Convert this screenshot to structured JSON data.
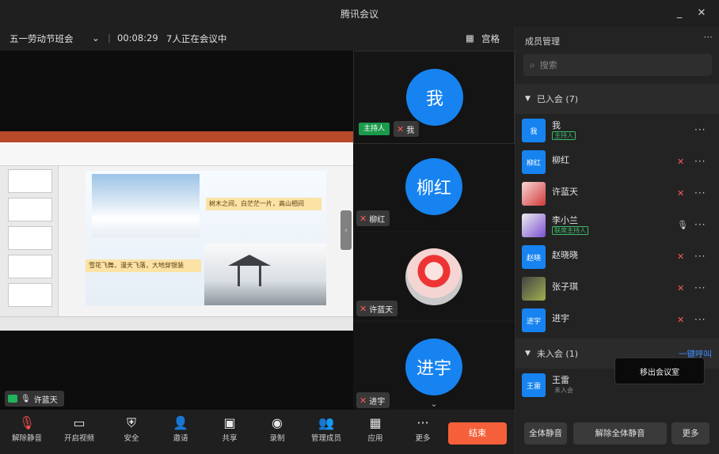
{
  "window": {
    "title": "腾讯会议",
    "buttons": {
      "minimize": "_",
      "close": "✕"
    }
  },
  "meeting_header": {
    "topic": "五一劳动节班会",
    "dropdown_icon": "chevron-down-icon",
    "elapsed": "00:08:29",
    "participants_status": "7人正在会议中",
    "grid_label": "宫格"
  },
  "stage": {
    "presenter_name": "许蓝天"
  },
  "slide": {
    "caption_top": "树木之间，白茫茫一片，高山相间",
    "caption_bottom": "雪花飞舞，漫天飞落，大地穿银装"
  },
  "tiles": [
    {
      "avatar_text": "我",
      "name": "我",
      "badge": "主持人",
      "mic": "muted"
    },
    {
      "avatar_text": "柳红",
      "name": "柳红",
      "mic": "muted"
    },
    {
      "avatar_text": "",
      "name": "许蓝天",
      "mic": "muted",
      "photo": true
    },
    {
      "avatar_text": "进宇",
      "name": "进宇",
      "mic": "muted"
    }
  ],
  "toolbar": {
    "items": [
      {
        "icon": "mic-off-icon",
        "label": "解除静音"
      },
      {
        "icon": "video-off-icon",
        "label": "开启视频"
      },
      {
        "icon": "safety-icon",
        "label": "安全"
      },
      {
        "icon": "invite-icon",
        "label": "邀请"
      },
      {
        "icon": "share-screen-icon",
        "label": "共享"
      },
      {
        "icon": "record-icon",
        "label": "录制"
      },
      {
        "icon": "members-icon",
        "label": "管理成员"
      },
      {
        "icon": "apps-icon",
        "label": "应用"
      },
      {
        "icon": "more-icon",
        "label": "更多"
      }
    ],
    "leave_label": "结束"
  },
  "panel": {
    "title": "成员管理",
    "search_placeholder": "搜索",
    "in_meeting_section": "已入会 (7)",
    "waiting_section": "未入会 (1)",
    "waiting_action": "一键呼叫",
    "members": [
      {
        "avatar": "我",
        "name": "我",
        "sub": "主持人",
        "mic": "muted"
      },
      {
        "avatar": "柳红",
        "name": "柳红",
        "mic": "muted"
      },
      {
        "avatar": "",
        "name": "许蓝天",
        "mic": "muted",
        "photo": "photo"
      },
      {
        "avatar": "",
        "name": "李小兰",
        "sub": "联席主持人",
        "mic": "on",
        "photo": "photo2"
      },
      {
        "avatar": "赵晓",
        "name": "赵晓晓",
        "mic": "muted"
      },
      {
        "avatar": "",
        "name": "张子琪",
        "mic": "muted",
        "photo": "photo3"
      },
      {
        "avatar": "进宇",
        "name": "进宇",
        "mic": "muted"
      }
    ],
    "waiting_member": {
      "avatar": "王雷",
      "name": "王雷",
      "sub": "未入会"
    },
    "tooltip": "移出会议室",
    "buttons": {
      "mute_all": "全体静音",
      "unmute_all": "解除全体静音",
      "more": "更多"
    }
  },
  "colors": {
    "accent": "#1683f0",
    "leave": "#f5603a",
    "mic_muted": "#ff5a5a",
    "link": "#3d8dff"
  }
}
